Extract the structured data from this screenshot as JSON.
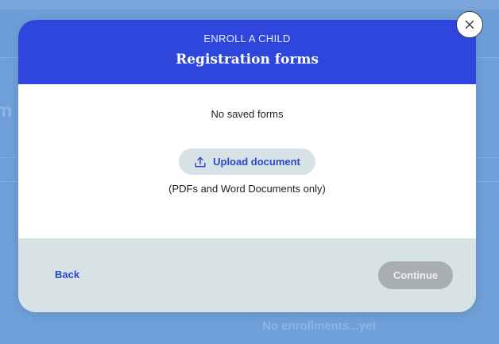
{
  "background": {
    "empty_text": "No enrollments...yet"
  },
  "modal": {
    "eyebrow": "ENROLL A CHILD",
    "title": "Registration forms",
    "empty_message": "No saved forms",
    "upload_label": "Upload document",
    "upload_icon": "upload-icon",
    "hint": "(PDFs and Word Documents only)",
    "back_label": "Back",
    "continue_label": "Continue",
    "close_icon": "close-icon"
  },
  "colors": {
    "header": "#2e46dc",
    "link": "#2d47c9",
    "footer": "#d6e2e3",
    "continue_disabled": "#a8aeb2"
  }
}
